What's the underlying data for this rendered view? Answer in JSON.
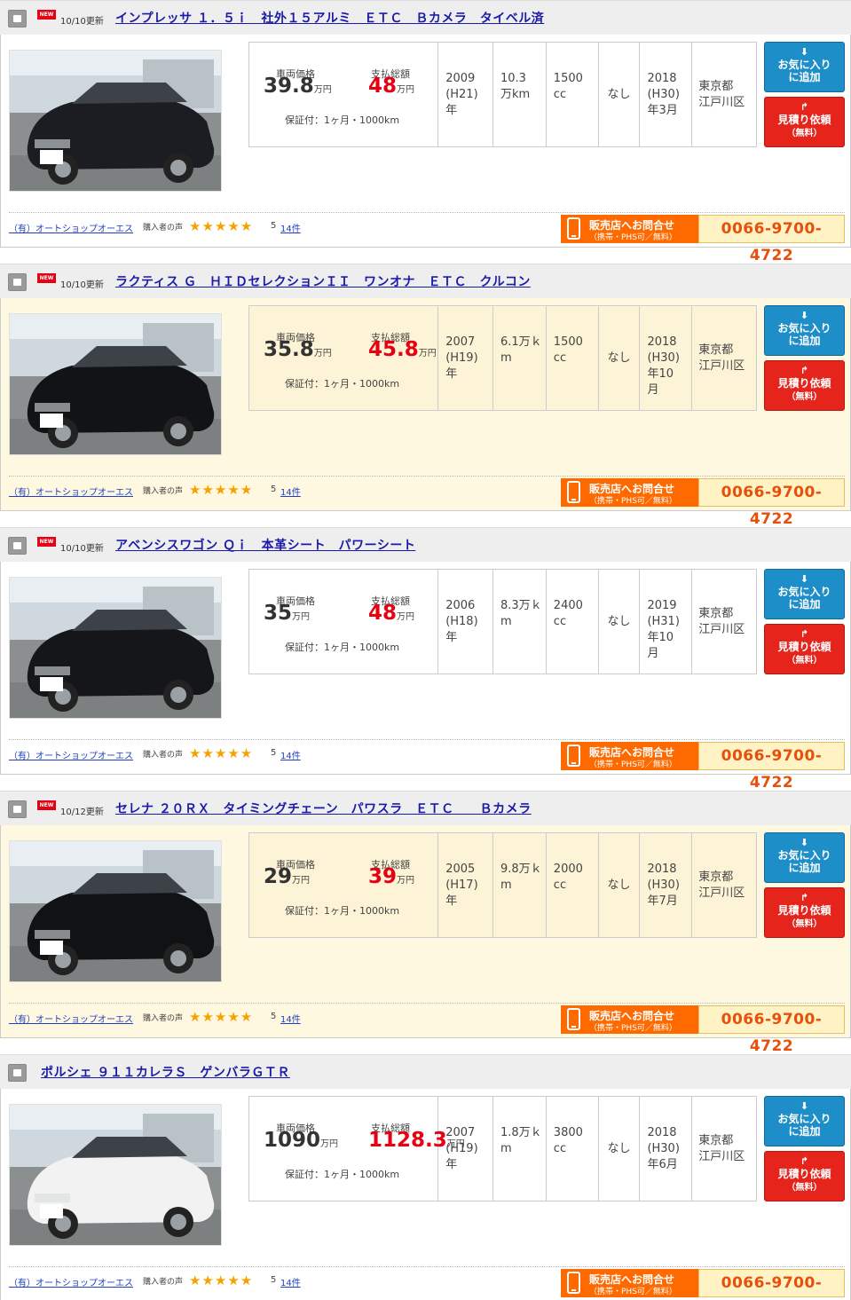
{
  "labels": {
    "vehicle_price": "車両価格",
    "total_price": "支払総額",
    "price_unit": "万円",
    "warranty": "保証付：1ヶ月・1000km",
    "favorite_line1": "お気に入り",
    "favorite_line2": "に追加",
    "estimate_line1": "見積り依頼",
    "estimate_line2": "（無料）",
    "buyer_voice": "購入者の声",
    "stars": "★★★★★",
    "inquiry_line1": "販売店へお問合せ",
    "inquiry_line2": "（携帯・PHS可／無料）",
    "new_badge": "NEW"
  },
  "shop": {
    "name": "（有）オートショップオーエス",
    "rating": "5",
    "review_count": "14件",
    "phone": "0066-9700-4722"
  },
  "listings": [
    {
      "is_new": true,
      "updated": "10/10更新",
      "title": "インプレッサ １．５ｉ　社外１５アルミ　ＥＴＣ　Ｂカメラ　タイベル済",
      "price": "39.8",
      "total": "48",
      "year": "2009\n(H21)\n年",
      "mileage": "10.3\n万km",
      "displacement": "1500\ncc",
      "repair": "なし",
      "inspection": "2018\n(H30)\n年3月",
      "location": "東京都\n江戸川区",
      "car_color": "#1b1d22"
    },
    {
      "is_new": true,
      "updated": "10/10更新",
      "title": "ラクティス Ｇ　ＨＩＤセレクションＩＩ　ワンオナ　ＥＴＣ　クルコン",
      "price": "35.8",
      "total": "45.8",
      "year": "2007\n(H19)\n年",
      "mileage": "6.1万ｋ\nm",
      "displacement": "1500\ncc",
      "repair": "なし",
      "inspection": "2018\n(H30)\n年10\n月",
      "location": "東京都\n江戸川区",
      "car_color": "#121316"
    },
    {
      "is_new": true,
      "updated": "10/10更新",
      "title": "アベンシスワゴン Ｑｉ　本革シート　パワーシート",
      "price": "35",
      "total": "48",
      "year": "2006\n(H18)\n年",
      "mileage": "8.3万ｋ\nm",
      "displacement": "2400\ncc",
      "repair": "なし",
      "inspection": "2019\n(H31)\n年10\n月",
      "location": "東京都\n江戸川区",
      "car_color": "#15161a"
    },
    {
      "is_new": true,
      "updated": "10/12更新",
      "title": "セレナ ２０ＲＸ　タイミングチェーン　パワスラ　ＥＴＣ　　Ｂカメラ",
      "price": "29",
      "total": "39",
      "year": "2005\n(H17)\n年",
      "mileage": "9.8万ｋ\nm",
      "displacement": "2000\ncc",
      "repair": "なし",
      "inspection": "2018\n(H30)\n年7月",
      "location": "東京都\n江戸川区",
      "car_color": "#111214"
    },
    {
      "is_new": false,
      "updated": "",
      "title": "ポルシェ ９１１カレラＳ　ゲンバラＧＴＲ",
      "price": "1090",
      "total": "1128.3",
      "year": "2007\n(H19)\n年",
      "mileage": "1.8万ｋ\nm",
      "displacement": "3800\ncc",
      "repair": "なし",
      "inspection": "2018\n(H30)\n年6月",
      "location": "東京都\n江戸川区",
      "car_color": "#f2f2f2"
    }
  ]
}
